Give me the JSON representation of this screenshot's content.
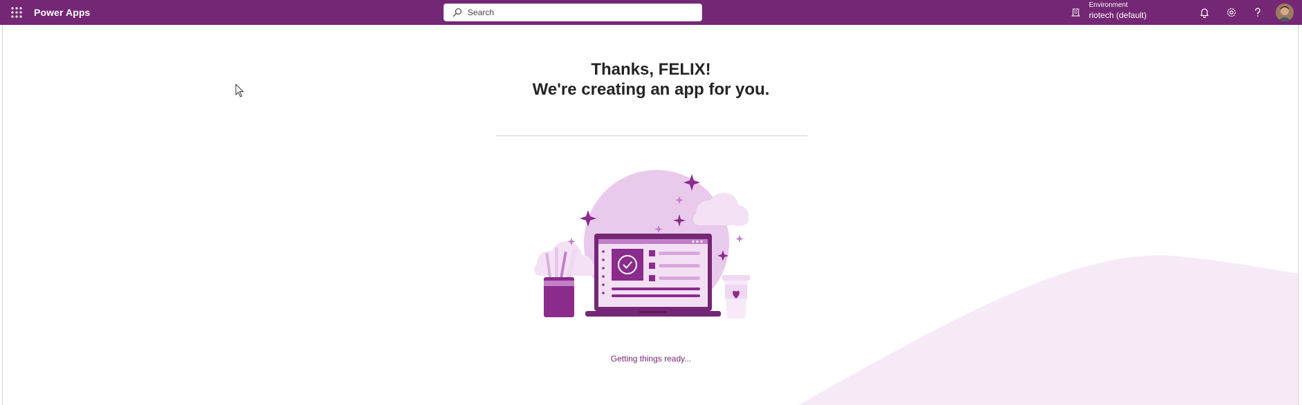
{
  "header": {
    "app_name": "Power Apps",
    "search_placeholder": "Search",
    "environment_label": "Environment",
    "environment_value": "riotech (default)"
  },
  "main": {
    "title_line1": "Thanks, FELIX!",
    "title_line2": "We're creating an app for you.",
    "status": "Getting things ready..."
  },
  "colors": {
    "brand": "#742774",
    "wave": "#f7eaf7",
    "illustration_light": "#e7c6e9",
    "illustration_dark": "#8b2b8c"
  },
  "icons": [
    "app-launcher-icon",
    "search-icon",
    "environment-icon",
    "bell-icon",
    "gear-icon",
    "help-icon"
  ]
}
